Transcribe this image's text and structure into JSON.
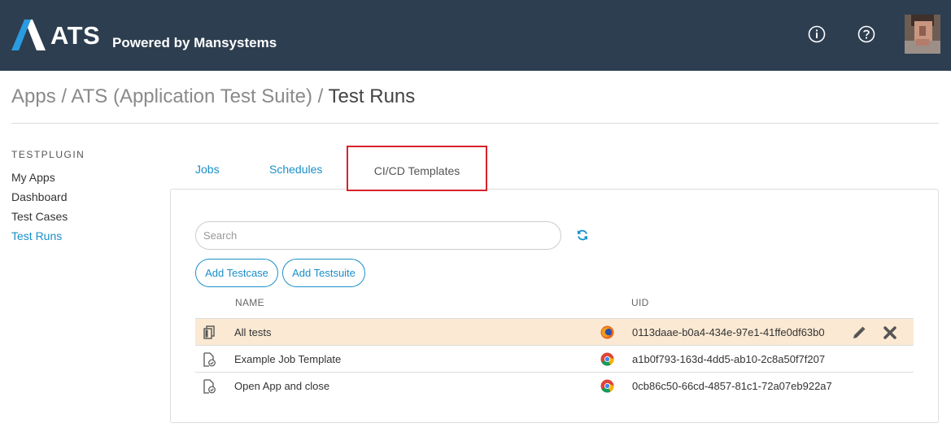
{
  "header": {
    "brand": "ATS",
    "tagline": "Powered by Mansystems",
    "icons": [
      "info-icon",
      "help-icon",
      "user-avatar"
    ],
    "bg_color": "#2d3e50"
  },
  "breadcrumb": {
    "part1": "Apps",
    "sep1": " / ",
    "part2": "ATS (Application Test Suite)",
    "sep2": " / ",
    "current": "Test Runs"
  },
  "sidebar": {
    "title": "TESTPLUGIN",
    "items": [
      {
        "label": "My Apps",
        "active": false
      },
      {
        "label": "Dashboard",
        "active": false
      },
      {
        "label": "Test Cases",
        "active": false
      },
      {
        "label": "Test Runs",
        "active": true
      }
    ]
  },
  "tabs": [
    {
      "label": "Jobs",
      "active": false
    },
    {
      "label": "Schedules",
      "active": false
    },
    {
      "label": "CI/CD Templates",
      "active": true
    }
  ],
  "toolbar": {
    "search_placeholder": "Search",
    "search_value": "",
    "refresh_icon": "refresh-icon",
    "add_testcase_label": "Add Testcase",
    "add_testsuite_label": "Add Testsuite"
  },
  "table": {
    "columns": [
      "NAME",
      "UID"
    ],
    "rows": [
      {
        "type_icon": "copy-icon",
        "name": "All tests",
        "browser": "firefox-icon",
        "uid": "0113daae-b0a4-434e-97e1-41ffe0df63b0",
        "highlighted": true,
        "actions": [
          "edit-icon",
          "delete-icon"
        ]
      },
      {
        "type_icon": "file-check-icon",
        "name": "Example Job Template",
        "browser": "chrome-icon",
        "uid": "a1b0f793-163d-4dd5-ab10-2c8a50f7f207",
        "highlighted": false
      },
      {
        "type_icon": "file-check-icon",
        "name": "Open App and close",
        "browser": "chrome-icon",
        "uid": "0cb86c50-66cd-4857-81c1-72a07eb922a7",
        "highlighted": false
      }
    ]
  },
  "colors": {
    "accent": "#1a8fc9",
    "highlight_row": "#fbe9d3",
    "active_tab_outline": "#d8222a"
  }
}
